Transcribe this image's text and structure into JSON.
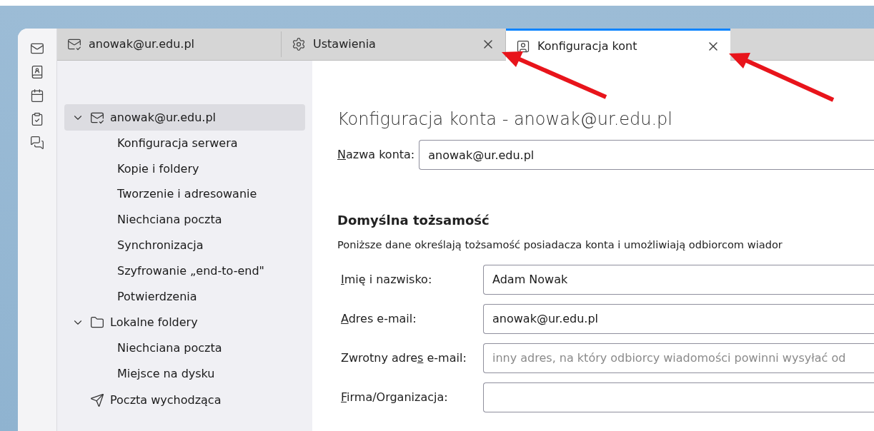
{
  "spaces": [
    {
      "kind": "mail"
    },
    {
      "kind": "contacts"
    },
    {
      "kind": "calendar"
    },
    {
      "kind": "tasks"
    },
    {
      "kind": "chat"
    }
  ],
  "tabs": [
    {
      "label": "anowak@ur.edu.pl",
      "kind": "account",
      "selected": false,
      "closable": false
    },
    {
      "label": "Ustawienia",
      "kind": "settings",
      "selected": false,
      "closable": true
    },
    {
      "label": "Konfiguracja kont",
      "kind": "accounts",
      "selected": true,
      "closable": true
    }
  ],
  "tree": [
    {
      "label": "anowak@ur.edu.pl",
      "kind": "account",
      "expanded": true,
      "selected": true,
      "children": [
        {
          "label": "Konfiguracja serwera",
          "selected": false
        },
        {
          "label": "Kopie i foldery",
          "selected": false
        },
        {
          "label": "Tworzenie i adresowanie",
          "selected": false
        },
        {
          "label": "Niechciana poczta",
          "selected": false
        },
        {
          "label": "Synchronizacja",
          "selected": false
        },
        {
          "label": "Szyfrowanie „end-to-end\"",
          "selected": false
        },
        {
          "label": "Potwierdzenia",
          "selected": false
        }
      ]
    },
    {
      "label": "Lokalne foldery",
      "kind": "folder",
      "expanded": true,
      "selected": false,
      "children": [
        {
          "label": "Niechciana poczta",
          "selected": false
        },
        {
          "label": "Miejsce na dysku",
          "selected": false
        }
      ]
    },
    {
      "label": "Poczta wychodząca",
      "kind": "outbox",
      "selected": false
    }
  ],
  "content": {
    "title": "Konfiguracja konta - anowak@ur.edu.pl",
    "account_name": {
      "label": {
        "key": "N",
        "post": "azwa konta:"
      },
      "value": "anowak@ur.edu.pl"
    },
    "section_title": "Domyślna tożsamość",
    "description": "Poniższe dane określają tożsamość posiadacza konta i umożliwiają odbiorcom wiador",
    "fields": [
      {
        "label": {
          "key": "I",
          "post": "mię i nazwisko:"
        },
        "value": "Adam Nowak"
      },
      {
        "label": {
          "key": "A",
          "post": "dres e-mail:"
        },
        "value": "anowak@ur.edu.pl"
      },
      {
        "label": {
          "pre": "Zwrotny adre",
          "key": "s",
          "post": " e-mail:"
        },
        "placeholder": "inny adres, na który odbiorcy wiadomości powinni wysyłać od"
      },
      {
        "label": {
          "key": "F",
          "post": "irma/Organizacja:"
        }
      }
    ]
  }
}
